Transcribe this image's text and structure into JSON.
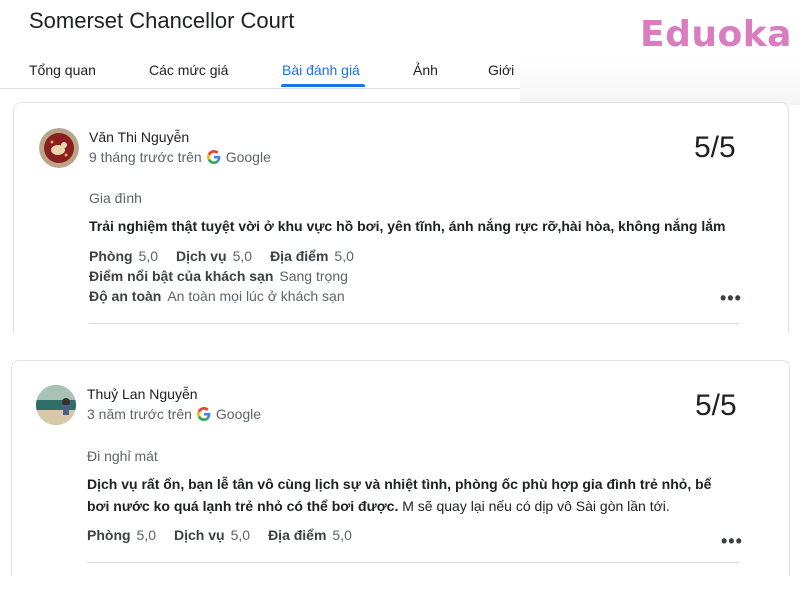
{
  "hotel": {
    "name": "Somerset Chancellor Court"
  },
  "brand": {
    "logo_text": "Eduoka",
    "color": "#d97cc0"
  },
  "tabs": [
    {
      "label": "Tổng quan"
    },
    {
      "label": "Các mức giá"
    },
    {
      "label": "Bài đánh giá",
      "active": true
    },
    {
      "label": "Ảnh"
    },
    {
      "label": "Giới"
    }
  ],
  "accent_color": "#1a73e8",
  "reviews": [
    {
      "author": "Văn Thi Nguyễn",
      "time": "9 tháng trước trên",
      "source": "Google",
      "rating": "5/5",
      "trip_type": "Gia đình",
      "text_bold": "Trải nghiệm thật tuyệt vời ở khu vực hồ bơi, yên tĩnh, ánh nắng rực rỡ,hài hòa, không nắng lắm",
      "scores": [
        {
          "label": "Phòng",
          "value": "5,0"
        },
        {
          "label": "Dịch vụ",
          "value": "5,0"
        },
        {
          "label": "Địa điểm",
          "value": "5,0"
        }
      ],
      "highlight": {
        "label": "Điểm nổi bật của khách sạn",
        "value": "Sang trọng"
      },
      "safety": {
        "label": "Độ an toàn",
        "value": "An toàn mọi lúc ở khách sạn"
      }
    },
    {
      "author": "Thuỷ Lan Nguyễn",
      "time": "3 năm trước trên",
      "source": "Google",
      "rating": "5/5",
      "trip_type": "Đi nghỉ mát",
      "text_bold_1": "Dịch vụ rất ổn, bạn lễ tân vô cùng lịch sự và nhiệt tình, phòng ốc phù hợp gia đình trẻ nhỏ, bể",
      "text_bold_2": "bơi nước ko quá lạnh trẻ nhỏ có thể bơi được.",
      "text_regular": " M sẽ quay lại nếu có dịp vô Sài gòn lần tới.",
      "scores": [
        {
          "label": "Phòng",
          "value": "5,0"
        },
        {
          "label": "Dịch vụ",
          "value": "5,0"
        },
        {
          "label": "Địa điểm",
          "value": "5,0"
        }
      ]
    }
  ],
  "more_label": "•••"
}
